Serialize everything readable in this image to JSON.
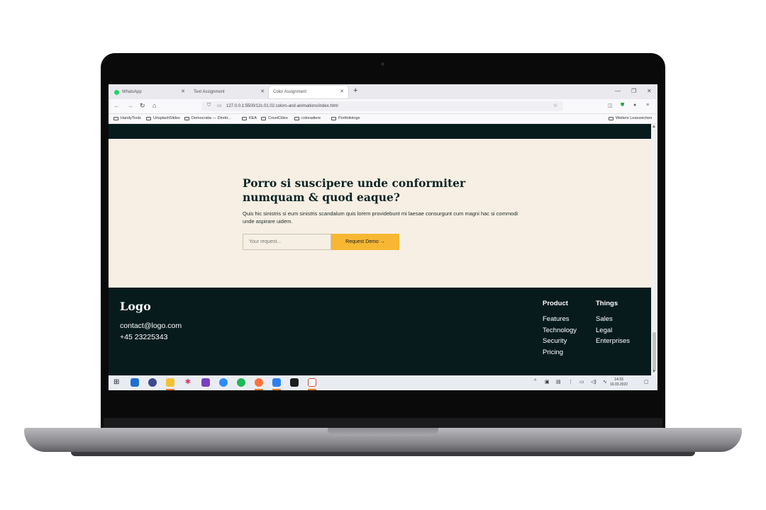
{
  "browser": {
    "tabs": [
      {
        "label": "WhatsApp",
        "active": false
      },
      {
        "label": "Text Assignment",
        "active": false
      },
      {
        "label": "Color Assignment",
        "active": true
      }
    ],
    "url": "127.0.0.1:5500/12c.01.02.colors-and-animations/index.html",
    "bookmarks": [
      "HandyTools",
      "UnsplashSlides",
      "Democratia — Direkt...",
      "KEA",
      "CoveiCities",
      "coloradiere",
      "Portfoliologo"
    ],
    "other_bookmarks": "Weitere Lesezeichen"
  },
  "cta": {
    "heading": "Porro si suscipere unde conformiter numquam & quod eaque?",
    "text": "Quis hic sinistris si eum sinistris scandalum quis lorem providebunt mi laesae consurgunt cum magni hac si commodi unde aspirare uidem.",
    "input_placeholder": "Your request...",
    "button_label": "Request Demo →"
  },
  "footer": {
    "logo": "Logo",
    "email": "contact@logo.com",
    "phone": "+45 23225343",
    "columns": [
      {
        "heading": "Product",
        "items": [
          "Features",
          "Technology",
          "Security",
          "Pricing"
        ]
      },
      {
        "heading": "Things",
        "items": [
          "Sales",
          "Legal",
          "Enterprises"
        ]
      }
    ]
  },
  "taskbar": {
    "time": "14:33",
    "date": "16.03.2022"
  },
  "colors": {
    "dark": "#071b1d",
    "cream": "#f7efe3",
    "accent": "#f7b733"
  }
}
